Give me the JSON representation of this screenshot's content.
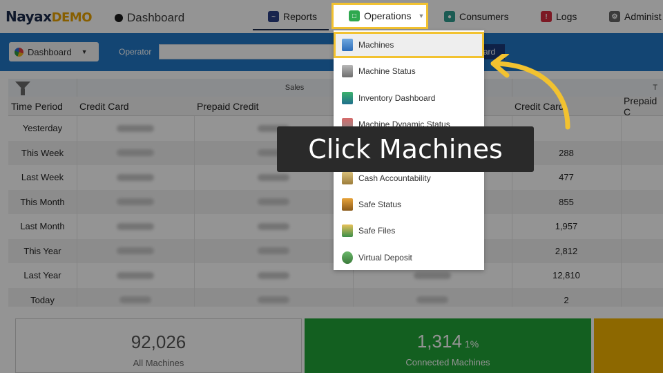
{
  "brand": {
    "name_part1": "Nayax",
    "name_part2": "DEMO"
  },
  "breadcrumb": {
    "page": "Dashboard"
  },
  "nav": {
    "reports": "Reports",
    "operations": "Operations",
    "consumers": "Consumers",
    "logs": "Logs",
    "admin": "Administ"
  },
  "toolbar": {
    "dashboard_select": "Dashboard",
    "operator_label": "Operator",
    "operator_value": "",
    "button_label": "ard"
  },
  "table": {
    "group_headers": {
      "sales": "Sales",
      "trailing": "T"
    },
    "columns": [
      "Time Period",
      "Credit Card",
      "Prepaid Credit",
      "Credit Card",
      "Prepaid C"
    ],
    "rows": [
      {
        "period": "Yesterday",
        "credit_card_2": ""
      },
      {
        "period": "This Week",
        "credit_card_2": "288"
      },
      {
        "period": "Last Week",
        "credit_card_2": "477"
      },
      {
        "period": "This Month",
        "credit_card_2": "855"
      },
      {
        "period": "Last Month",
        "credit_card_2": "1,957"
      },
      {
        "period": "This Year",
        "credit_card_2": "2,812"
      },
      {
        "period": "Last Year",
        "credit_card_2": "12,810"
      },
      {
        "period": "Today",
        "credit_card_2": "2"
      }
    ]
  },
  "cards": {
    "all_machines": {
      "value": "92,026",
      "label": "All Machines"
    },
    "connected": {
      "value": "1,314",
      "percent": "1%",
      "label": "Connected Machines"
    }
  },
  "dropdown": {
    "items": [
      {
        "label": "Machines",
        "icon": "machine-icon"
      },
      {
        "label": "Machine Status",
        "icon": "machine-status-icon"
      },
      {
        "label": "Inventory Dashboard",
        "icon": "inventory-icon"
      },
      {
        "label": "Machine Dynamic Status",
        "icon": "dynamic-status-icon"
      },
      {
        "label": "",
        "icon": "obscured-icon"
      },
      {
        "label": "Cash Accountability",
        "icon": "cash-icon"
      },
      {
        "label": "Safe Status",
        "icon": "safe-icon"
      },
      {
        "label": "Safe Files",
        "icon": "safe-files-icon"
      },
      {
        "label": "Virtual Deposit",
        "icon": "virtual-deposit-icon"
      }
    ]
  },
  "callout": {
    "text": "Click Machines"
  },
  "colors": {
    "highlight": "#f2c230",
    "toolbar": "#2178c7",
    "green_card": "#22a437",
    "yellow_card": "#f3b300"
  }
}
